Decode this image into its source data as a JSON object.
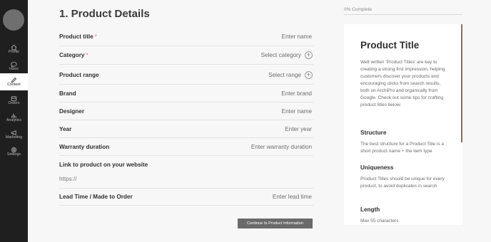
{
  "sidebar": {
    "items": [
      {
        "label": "Profile",
        "icon": "home-icon"
      },
      {
        "label": "Inbox",
        "icon": "chat-icon"
      },
      {
        "label": "Content",
        "icon": "pencil-icon",
        "active": true
      },
      {
        "label": "Orders",
        "icon": "orders-icon"
      },
      {
        "label": "Analytics",
        "icon": "analytics-icon"
      },
      {
        "label": "Marketing",
        "icon": "megaphone-icon"
      },
      {
        "label": "Settings",
        "icon": "gear-icon"
      }
    ]
  },
  "form": {
    "title": "1. Product Details",
    "fields": {
      "product_title": {
        "label": "Product title",
        "required": "*",
        "placeholder": "Enter name"
      },
      "category": {
        "label": "Category",
        "required": "*",
        "placeholder": "Select category"
      },
      "product_range": {
        "label": "Product range",
        "placeholder": "Select range"
      },
      "brand": {
        "label": "Brand",
        "placeholder": "Enter brand"
      },
      "designer": {
        "label": "Designer",
        "placeholder": "Enter name"
      },
      "year": {
        "label": "Year",
        "placeholder": "Enter year"
      },
      "warranty": {
        "label": "Warranty duration",
        "placeholder": "Enter warranty duration"
      },
      "link": {
        "label": "Link to product on your website",
        "placeholder": "https://"
      },
      "lead_time": {
        "label": "Lead Time / Made to Order",
        "placeholder": "Enter lead time"
      }
    },
    "plus_glyph": "+",
    "continue_label": "Continue to Product Information"
  },
  "progress": {
    "label": "0% Complete",
    "value": 0
  },
  "help": {
    "title": "Product Title",
    "intro": "Well written 'Product Titles' are key to creating a strong first impression, helping customers discover your products and encouraging clicks from search results, both on ArchiPro and organically from Google. Check out some tips for crafting product titles below.",
    "sections": [
      {
        "heading": "Structure",
        "text": "The best structure for a Product Title is a short product name + the item type"
      },
      {
        "heading": "Uniqueness",
        "text": "Product Titles should be unique for every product, to avoid duplicates in search"
      },
      {
        "heading": "Length",
        "text": "Max 55 characters"
      }
    ]
  }
}
